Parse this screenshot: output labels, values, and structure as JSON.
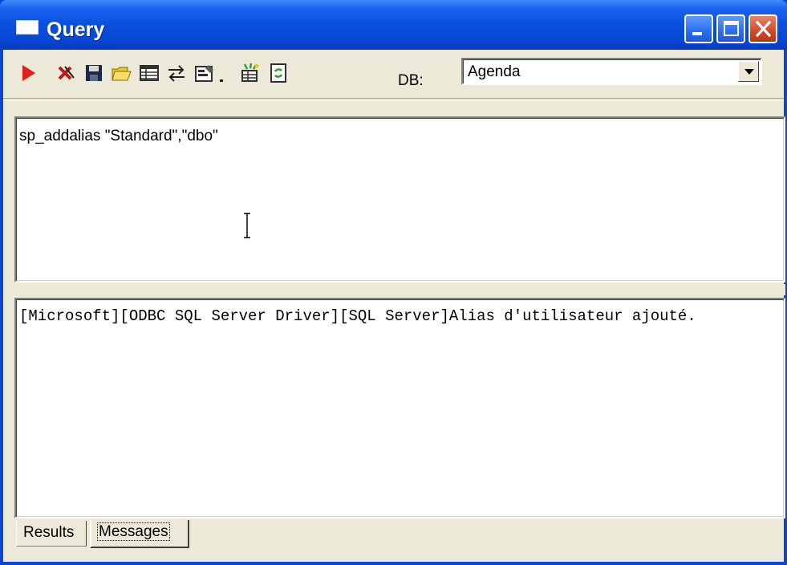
{
  "window": {
    "title": "Query"
  },
  "titlebar_buttons": {
    "minimize": "minimize-icon",
    "maximize": "maximize-icon",
    "close": "close-icon"
  },
  "toolbar": {
    "tools": [
      {
        "icon": "run-icon"
      },
      {
        "icon": "cancel-query-icon"
      },
      {
        "icon": "save-icon"
      },
      {
        "icon": "open-icon"
      },
      {
        "icon": "results-grid-icon"
      },
      {
        "icon": "swap-icon"
      },
      {
        "icon": "properties-icon"
      },
      {
        "icon": "dropdown-arrow-icon"
      },
      {
        "icon": "tables-icon"
      },
      {
        "icon": "refresh-icon"
      }
    ],
    "db_label": "DB:",
    "db_value": "Agenda"
  },
  "query": {
    "text": "sp_addalias \"Standard\",\"dbo\""
  },
  "messages": {
    "text": "[Microsoft][ODBC SQL Server Driver][SQL Server]Alias d'utilisateur ajouté."
  },
  "tabs": {
    "results": "Results",
    "messages": "Messages",
    "active": "Messages"
  },
  "colors": {
    "titlebar": "#0a52e0",
    "face": "#ece9d8",
    "close_button": "#d24a25"
  }
}
